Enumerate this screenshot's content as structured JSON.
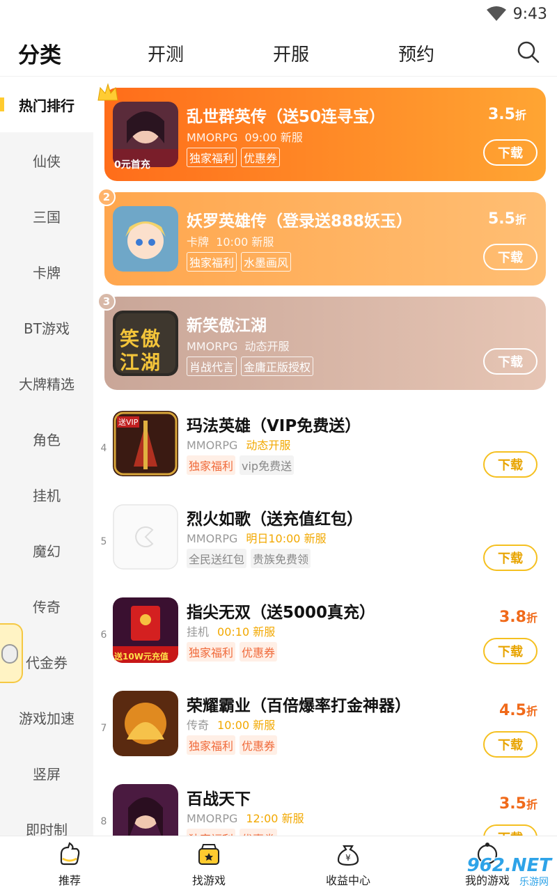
{
  "status_bar": {
    "time": "9:43"
  },
  "top_nav": {
    "tabs": [
      "分类",
      "开测",
      "开服",
      "预约"
    ]
  },
  "sidebar": {
    "items": [
      "热门排行",
      "仙侠",
      "三国",
      "卡牌",
      "BT游戏",
      "大牌精选",
      "角色",
      "挂机",
      "魔幻",
      "传奇",
      "代金券",
      "游戏加速",
      "竖屏",
      "即时制"
    ]
  },
  "games": [
    {
      "rank": "1",
      "name": "乱世群英传（送50连寻宝）",
      "category": "MMORPG",
      "open": "09:00 新服",
      "tags": [
        "独家福利",
        "优惠券"
      ],
      "discount": "3.5",
      "discount_unit": "折",
      "download": "下载",
      "icon_text": "0元首充"
    },
    {
      "rank": "2",
      "name": "妖罗英雄传（登录送888妖玉）",
      "category": "卡牌",
      "open": "10:00 新服",
      "tags": [
        "独家福利",
        "水墨画风"
      ],
      "discount": "5.5",
      "discount_unit": "折",
      "download": "下载"
    },
    {
      "rank": "3",
      "name": "新笑傲江湖",
      "category": "MMORPG",
      "open": "动态开服",
      "tags": [
        "肖战代言",
        "金庸正版授权"
      ],
      "discount": "",
      "discount_unit": "",
      "download": "下载",
      "icon_text": "笑傲江湖"
    },
    {
      "rank": "4",
      "name": "玛法英雄（VIP免费送）",
      "category": "MMORPG",
      "open": "动态开服",
      "tags": [
        "独家福利",
        "vip免费送"
      ],
      "discount": "",
      "discount_unit": "",
      "download": "下载",
      "icon_text": "送VIP"
    },
    {
      "rank": "5",
      "name": "烈火如歌（送充值红包）",
      "category": "MMORPG",
      "open": "明日10:00 新服",
      "tags": [
        "全民送红包",
        "贵族免费领"
      ],
      "discount": "",
      "discount_unit": "",
      "download": "下载"
    },
    {
      "rank": "6",
      "name": "指尖无双（送5000真充）",
      "category": "挂机",
      "open": "00:10 新服",
      "tags": [
        "独家福利",
        "优惠券"
      ],
      "discount": "3.8",
      "discount_unit": "折",
      "download": "下载",
      "icon_text": "送10W元充值"
    },
    {
      "rank": "7",
      "name": "荣耀霸业（百倍爆率打金神器）",
      "category": "传奇",
      "open": "10:00 新服",
      "tags": [
        "独家福利",
        "优惠券"
      ],
      "discount": "4.5",
      "discount_unit": "折",
      "download": "下载"
    },
    {
      "rank": "8",
      "name": "百战天下",
      "category": "MMORPG",
      "open": "12:00 新服",
      "tags": [
        "独家福利",
        "优惠券"
      ],
      "discount": "3.5",
      "discount_unit": "折",
      "download": "下载"
    }
  ],
  "bottom_nav": {
    "items": [
      "推荐",
      "找游戏",
      "收益中心",
      "我的游戏"
    ]
  },
  "watermark": {
    "text": "962.NET",
    "sub": "乐游网"
  },
  "colors": {
    "accent": "#FFCB2F",
    "rank1": "#FF6D1A",
    "rank2": "#FFA64D",
    "rank3": "#C9A698",
    "discount": "#F06A1A"
  }
}
